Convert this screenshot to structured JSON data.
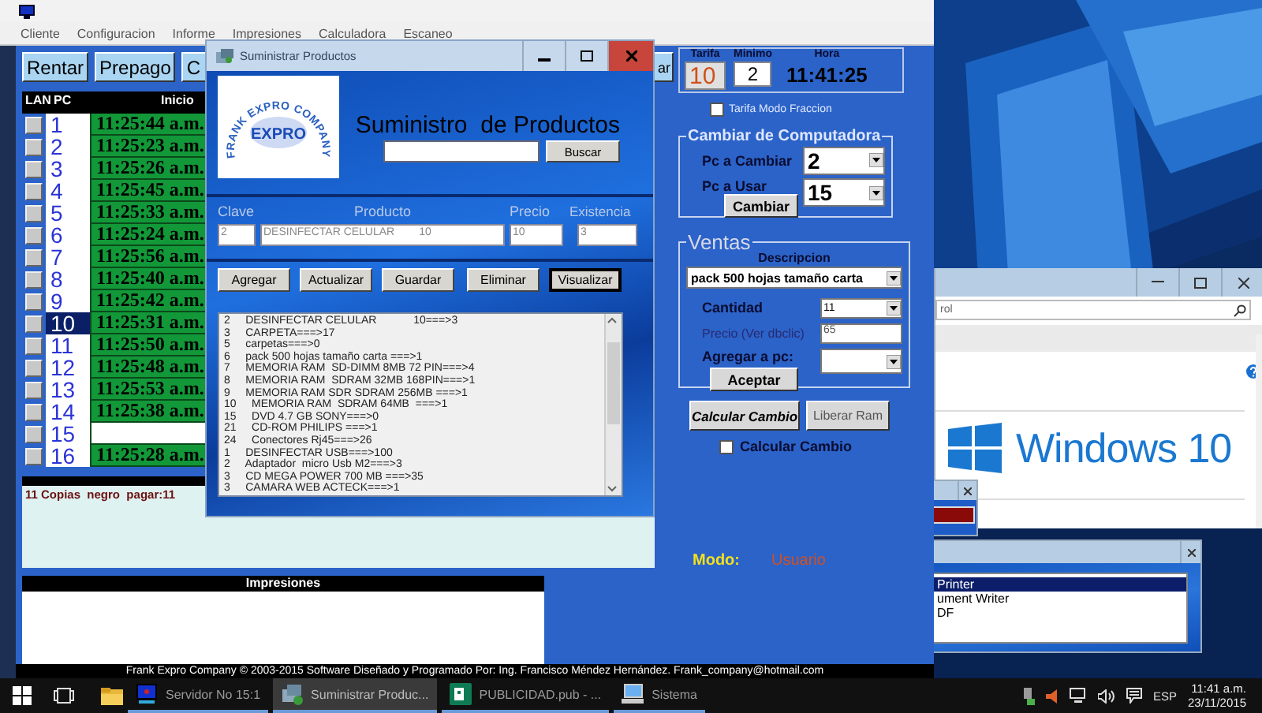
{
  "main_window": {
    "menu": [
      "Cliente",
      "Configuracion",
      "Informe",
      "Impresiones",
      "Calculadora",
      "Escaneo"
    ],
    "toolbar": [
      "Rentar",
      "Prepago",
      "C",
      "ar"
    ],
    "table": {
      "columns": [
        "LAN",
        "PC",
        "Inicio"
      ],
      "rows": [
        {
          "lan": false,
          "pc": "1",
          "inicio": "11:25:44 a.m.",
          "selected": false
        },
        {
          "lan": false,
          "pc": "2",
          "inicio": "11:25:23 a.m.",
          "selected": false
        },
        {
          "lan": false,
          "pc": "3",
          "inicio": "11:25:26 a.m.",
          "selected": false
        },
        {
          "lan": false,
          "pc": "4",
          "inicio": "11:25:45 a.m.",
          "selected": false
        },
        {
          "lan": false,
          "pc": "5",
          "inicio": "11:25:33 a.m.",
          "selected": false
        },
        {
          "lan": false,
          "pc": "6",
          "inicio": "11:25:24 a.m.",
          "selected": false
        },
        {
          "lan": false,
          "pc": "7",
          "inicio": "11:25:56 a.m.",
          "selected": false
        },
        {
          "lan": false,
          "pc": "8",
          "inicio": "11:25:40 a.m.",
          "selected": false
        },
        {
          "lan": false,
          "pc": "9",
          "inicio": "11:25:42 a.m.",
          "selected": false
        },
        {
          "lan": false,
          "pc": "10",
          "inicio": "11:25:31 a.m.",
          "selected": true
        },
        {
          "lan": false,
          "pc": "11",
          "inicio": "11:25:50 a.m.",
          "selected": false
        },
        {
          "lan": false,
          "pc": "12",
          "inicio": "11:25:48 a.m.",
          "selected": false
        },
        {
          "lan": false,
          "pc": "13",
          "inicio": "11:25:53 a.m.",
          "selected": false
        },
        {
          "lan": false,
          "pc": "14",
          "inicio": "11:25:38 a.m.",
          "selected": false
        },
        {
          "lan": false,
          "pc": "15",
          "selected": false
        },
        {
          "lan": false,
          "pc": "16",
          "inicio": "11:25:28 a.m.",
          "selected": false
        }
      ]
    },
    "print_log": "11 Copias  negro  pagar:11",
    "impresiones": "Impresiones",
    "rate": {
      "tarifa_label": "Tarifa",
      "tarifa": "10",
      "minimo_label": "Minimo",
      "minimo": "2",
      "hora_label": "Hora",
      "hora": "11:41:25"
    },
    "fraccion": {
      "label": "Tarifa Modo Fraccion",
      "checked": false
    },
    "cambiar": {
      "title": "Cambiar de Computadora",
      "pc_cambiar_label": "Pc a Cambiar",
      "pc_cambiar": "2",
      "pc_usar_label": "Pc a Usar",
      "pc_usar": "15",
      "button": "Cambiar"
    },
    "ventas": {
      "title": "Ventas",
      "descripcion_label": "Descripcion",
      "descripcion": "pack 500 hojas tamaño carta",
      "cantidad_label": "Cantidad",
      "cantidad": "11",
      "precio_label": "Precio (Ver dbclic)",
      "precio": "65",
      "agregar_label": "Agregar a pc:",
      "button": "Aceptar"
    },
    "calcular_button": "Calcular Cambio",
    "liberar_button": "Liberar Ram",
    "calcular_check": {
      "label": "Calcular Cambio",
      "checked": false
    },
    "mode": {
      "label": "Modo:",
      "value": "Usuario"
    },
    "footer": "Frank Expro Company © 2003-2015 Software Diseñado y Programado Por: Ing. Francisco Méndez Hernández.  Frank_company@hotmail.com"
  },
  "dialog": {
    "title": "Suministrar Productos",
    "logo": {
      "ring": "FRANK EXPRO COMPANY",
      "center": "EXPRO"
    },
    "heading": "Suministro  de Productos",
    "search_button": "Buscar",
    "fields": [
      {
        "label": "Clave",
        "value": "2"
      },
      {
        "label": "Producto",
        "value": "DESINFECTAR CELULAR        10"
      },
      {
        "label": "Precio",
        "value": "10"
      },
      {
        "label": "Existencia",
        "value": "3"
      }
    ],
    "buttons": [
      {
        "label": "Agregar",
        "focused": false
      },
      {
        "label": "Actualizar",
        "focused": false
      },
      {
        "label": "Guardar",
        "focused": false
      },
      {
        "label": "Eliminar",
        "focused": false
      },
      {
        "label": "Visualizar",
        "focused": true
      }
    ],
    "list": [
      "2     DESINFECTAR CELULAR            10===>3",
      "3     CARPETA===>17",
      "5     carpetas===>0",
      "6     pack 500 hojas tamaño carta ===>1",
      "7     MEMORIA RAM  SD-DIMM 8MB 72 PIN===>4",
      "8     MEMORIA RAM  SDRAM 32MB 168PIN===>1",
      "9     MEMORIA RAM SDR SDRAM 256MB ===>1",
      "10     MEMORIA RAM  SDRAM 64MB  ===>1",
      "15     DVD 4.7 GB SONY===>0",
      "21     CD-ROM PHILIPS ===>1",
      "24     Conectores Rj45===>26",
      "1     DESINFECTAR USB===>100",
      "2     Adaptador  micro Usb M2===>3",
      "3     CD MEGA POWER 700 MB ===>35",
      "3     CAMARA WEB ACTECK===>1"
    ]
  },
  "control_panel": {
    "search": "rol",
    "logo_text": "Windows 10"
  },
  "printer_window": {
    "items": [
      {
        "label": "Printer",
        "selected": true
      },
      {
        "label": "ument Writer",
        "selected": false
      },
      {
        "label": "DF",
        "selected": false
      }
    ]
  },
  "taskbar": {
    "items": [
      {
        "kind": "server",
        "label": "Servidor No 15:1",
        "active": false
      },
      {
        "kind": "supply",
        "label": "Suministrar Produc...",
        "active": true
      },
      {
        "kind": "publisher",
        "label": "PUBLICIDAD.pub - ...",
        "active": false
      },
      {
        "kind": "system",
        "label": "Sistema",
        "active": false
      }
    ],
    "language": "ESP",
    "time": "11:41 a.m.",
    "date": "23/11/2015"
  }
}
